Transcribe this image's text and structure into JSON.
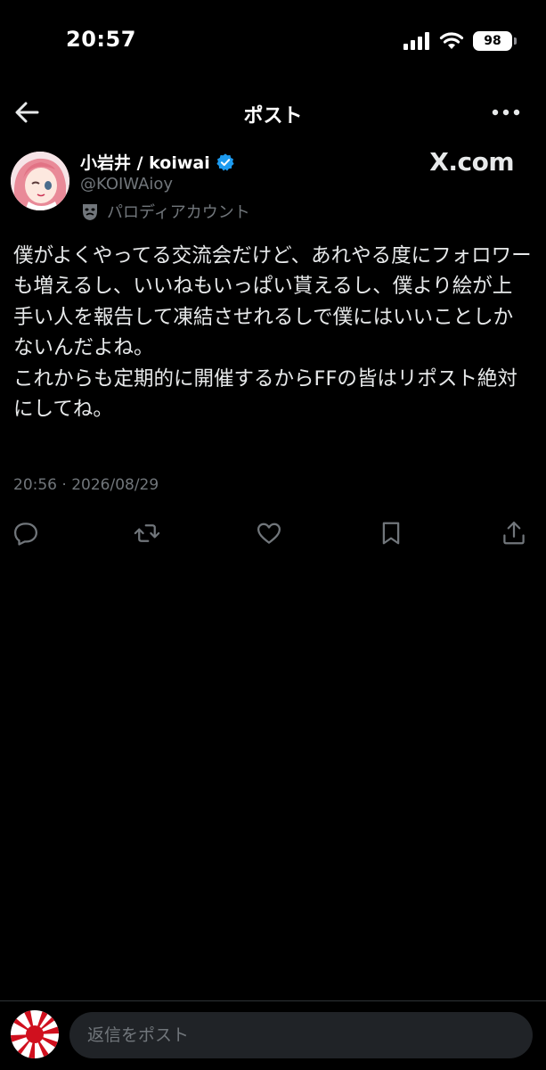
{
  "status_bar": {
    "time": "20:57",
    "battery": "98"
  },
  "header": {
    "title": "ポスト"
  },
  "author": {
    "display_name": "小岩井 / koiwai",
    "handle": "@KOIWAioy",
    "label": "パロディアカウント",
    "watermark": "X.com"
  },
  "post": {
    "text": "僕がよくやってる交流会だけど、あれやる度にフォロワーも増えるし、いいねもいっぱい貰えるし、僕より絵が上手い人を報告して凍結させれるしで僕にはいいことしかないんだよね。\nこれからも定期的に開催するからFFの皆はリポスト絶対にしてね。",
    "timestamp": "20:56 · 2026/08/29"
  },
  "actions": [
    "reply-icon",
    "repost-icon",
    "like-icon",
    "bookmark-icon",
    "share-icon"
  ],
  "reply_bar": {
    "placeholder": "返信をポスト"
  },
  "colors": {
    "background": "#000000",
    "text": "#e7e9ea",
    "muted": "#71767b",
    "verified": "#1d9bf0",
    "input_bg": "#202327"
  }
}
